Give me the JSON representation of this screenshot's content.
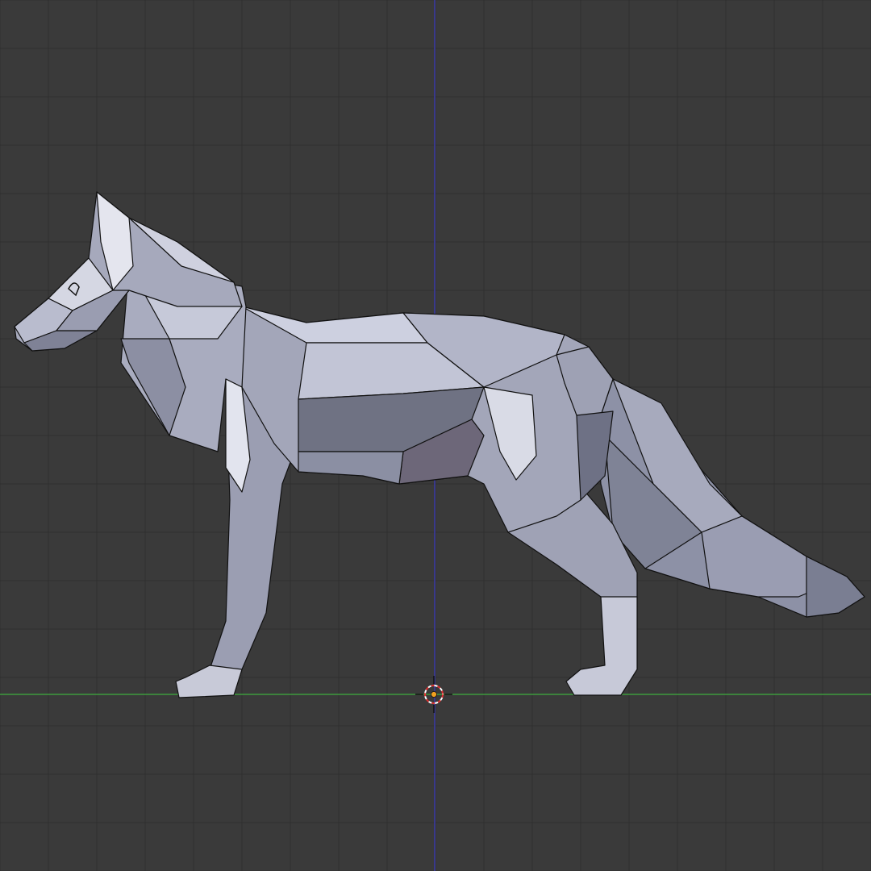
{
  "viewport": {
    "background": "#3a3a3a",
    "grid_color": "#303030",
    "x_axis_color": "#3c9a3c",
    "z_axis_color": "#3a3aa8"
  },
  "model": {
    "icon": "fox-mesh",
    "fill": "#b6b9cc",
    "wire_color": "#111111"
  },
  "cursor": {
    "icon": "3d-cursor-icon",
    "ring_colors": [
      "#e03030",
      "#ffffff"
    ],
    "origin_color": "#f0a020"
  }
}
